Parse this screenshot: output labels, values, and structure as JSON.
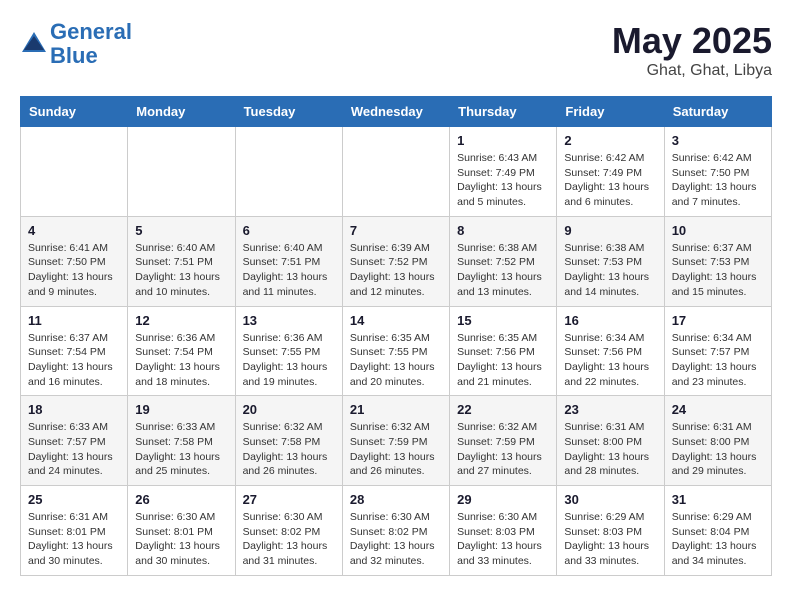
{
  "header": {
    "logo_line1": "General",
    "logo_line2": "Blue",
    "month": "May 2025",
    "location": "Ghat, Ghat, Libya"
  },
  "weekdays": [
    "Sunday",
    "Monday",
    "Tuesday",
    "Wednesday",
    "Thursday",
    "Friday",
    "Saturday"
  ],
  "weeks": [
    [
      {
        "day": "",
        "info": ""
      },
      {
        "day": "",
        "info": ""
      },
      {
        "day": "",
        "info": ""
      },
      {
        "day": "",
        "info": ""
      },
      {
        "day": "1",
        "info": "Sunrise: 6:43 AM\nSunset: 7:49 PM\nDaylight: 13 hours\nand 5 minutes."
      },
      {
        "day": "2",
        "info": "Sunrise: 6:42 AM\nSunset: 7:49 PM\nDaylight: 13 hours\nand 6 minutes."
      },
      {
        "day": "3",
        "info": "Sunrise: 6:42 AM\nSunset: 7:50 PM\nDaylight: 13 hours\nand 7 minutes."
      }
    ],
    [
      {
        "day": "4",
        "info": "Sunrise: 6:41 AM\nSunset: 7:50 PM\nDaylight: 13 hours\nand 9 minutes."
      },
      {
        "day": "5",
        "info": "Sunrise: 6:40 AM\nSunset: 7:51 PM\nDaylight: 13 hours\nand 10 minutes."
      },
      {
        "day": "6",
        "info": "Sunrise: 6:40 AM\nSunset: 7:51 PM\nDaylight: 13 hours\nand 11 minutes."
      },
      {
        "day": "7",
        "info": "Sunrise: 6:39 AM\nSunset: 7:52 PM\nDaylight: 13 hours\nand 12 minutes."
      },
      {
        "day": "8",
        "info": "Sunrise: 6:38 AM\nSunset: 7:52 PM\nDaylight: 13 hours\nand 13 minutes."
      },
      {
        "day": "9",
        "info": "Sunrise: 6:38 AM\nSunset: 7:53 PM\nDaylight: 13 hours\nand 14 minutes."
      },
      {
        "day": "10",
        "info": "Sunrise: 6:37 AM\nSunset: 7:53 PM\nDaylight: 13 hours\nand 15 minutes."
      }
    ],
    [
      {
        "day": "11",
        "info": "Sunrise: 6:37 AM\nSunset: 7:54 PM\nDaylight: 13 hours\nand 16 minutes."
      },
      {
        "day": "12",
        "info": "Sunrise: 6:36 AM\nSunset: 7:54 PM\nDaylight: 13 hours\nand 18 minutes."
      },
      {
        "day": "13",
        "info": "Sunrise: 6:36 AM\nSunset: 7:55 PM\nDaylight: 13 hours\nand 19 minutes."
      },
      {
        "day": "14",
        "info": "Sunrise: 6:35 AM\nSunset: 7:55 PM\nDaylight: 13 hours\nand 20 minutes."
      },
      {
        "day": "15",
        "info": "Sunrise: 6:35 AM\nSunset: 7:56 PM\nDaylight: 13 hours\nand 21 minutes."
      },
      {
        "day": "16",
        "info": "Sunrise: 6:34 AM\nSunset: 7:56 PM\nDaylight: 13 hours\nand 22 minutes."
      },
      {
        "day": "17",
        "info": "Sunrise: 6:34 AM\nSunset: 7:57 PM\nDaylight: 13 hours\nand 23 minutes."
      }
    ],
    [
      {
        "day": "18",
        "info": "Sunrise: 6:33 AM\nSunset: 7:57 PM\nDaylight: 13 hours\nand 24 minutes."
      },
      {
        "day": "19",
        "info": "Sunrise: 6:33 AM\nSunset: 7:58 PM\nDaylight: 13 hours\nand 25 minutes."
      },
      {
        "day": "20",
        "info": "Sunrise: 6:32 AM\nSunset: 7:58 PM\nDaylight: 13 hours\nand 26 minutes."
      },
      {
        "day": "21",
        "info": "Sunrise: 6:32 AM\nSunset: 7:59 PM\nDaylight: 13 hours\nand 26 minutes."
      },
      {
        "day": "22",
        "info": "Sunrise: 6:32 AM\nSunset: 7:59 PM\nDaylight: 13 hours\nand 27 minutes."
      },
      {
        "day": "23",
        "info": "Sunrise: 6:31 AM\nSunset: 8:00 PM\nDaylight: 13 hours\nand 28 minutes."
      },
      {
        "day": "24",
        "info": "Sunrise: 6:31 AM\nSunset: 8:00 PM\nDaylight: 13 hours\nand 29 minutes."
      }
    ],
    [
      {
        "day": "25",
        "info": "Sunrise: 6:31 AM\nSunset: 8:01 PM\nDaylight: 13 hours\nand 30 minutes."
      },
      {
        "day": "26",
        "info": "Sunrise: 6:30 AM\nSunset: 8:01 PM\nDaylight: 13 hours\nand 30 minutes."
      },
      {
        "day": "27",
        "info": "Sunrise: 6:30 AM\nSunset: 8:02 PM\nDaylight: 13 hours\nand 31 minutes."
      },
      {
        "day": "28",
        "info": "Sunrise: 6:30 AM\nSunset: 8:02 PM\nDaylight: 13 hours\nand 32 minutes."
      },
      {
        "day": "29",
        "info": "Sunrise: 6:30 AM\nSunset: 8:03 PM\nDaylight: 13 hours\nand 33 minutes."
      },
      {
        "day": "30",
        "info": "Sunrise: 6:29 AM\nSunset: 8:03 PM\nDaylight: 13 hours\nand 33 minutes."
      },
      {
        "day": "31",
        "info": "Sunrise: 6:29 AM\nSunset: 8:04 PM\nDaylight: 13 hours\nand 34 minutes."
      }
    ]
  ]
}
